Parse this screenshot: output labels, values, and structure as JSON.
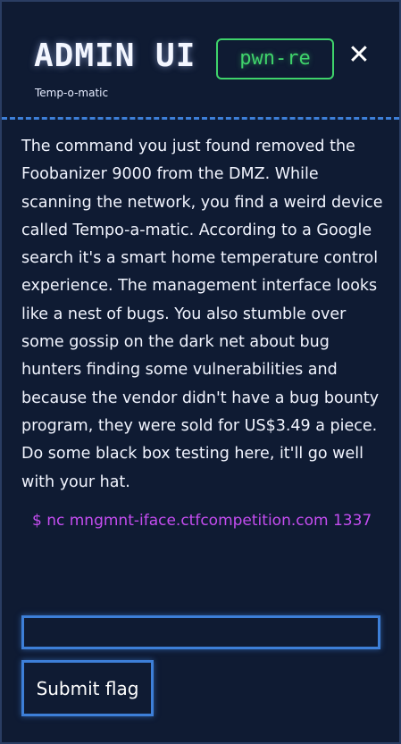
{
  "modal": {
    "title": "ADMIN UI",
    "subtitle": "Temp-o-matic",
    "badge": "pwn-re",
    "close_label": "✕",
    "description": "The command you just found removed the Foobanizer 9000 from the DMZ. While scanning the network, you find a weird device called Tempo-a-matic. According to a Google search it's a smart home temperature control experience. The management interface looks like a nest of bugs. You also stumble over some gossip on the dark net about bug hunters finding some vulnerabilities and because the vendor didn't have a bug bounty program, they were sold for US$3.49 a piece. Do some black box testing here, it'll go well with your hat.",
    "command": "$ nc mngmnt-iface.ctfcompetition.com 1337",
    "flag_input": {
      "value": "",
      "placeholder": ""
    },
    "submit_label": "Submit flag"
  },
  "colors": {
    "background": "#0f1b33",
    "accent_blue": "#3d7fd8",
    "badge_green": "#3fd36b",
    "command_purple": "#c44df0"
  }
}
